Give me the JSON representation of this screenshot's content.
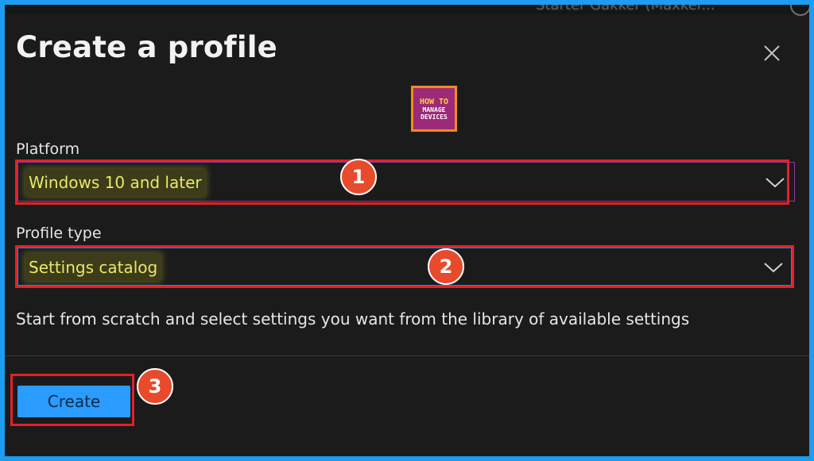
{
  "background_text": "Starter Gakker (Maxker...",
  "dialog": {
    "title": "Create a profile",
    "close_icon": "close-icon"
  },
  "logo": {
    "line1": "HOW TO",
    "line2": "MANAGE",
    "line3": "DEVICES"
  },
  "platform": {
    "label": "Platform",
    "value": "Windows 10 and later"
  },
  "profile_type": {
    "label": "Profile type",
    "value": "Settings catalog",
    "description": "Start from scratch and select settings you want from the library of available settings"
  },
  "actions": {
    "create_label": "Create"
  },
  "markers": [
    "1",
    "2",
    "3"
  ],
  "colors": {
    "accent": "#2a9bff",
    "highlight": "#e3202a",
    "marker": "#e84a2c",
    "background": "#1b1b1b"
  }
}
